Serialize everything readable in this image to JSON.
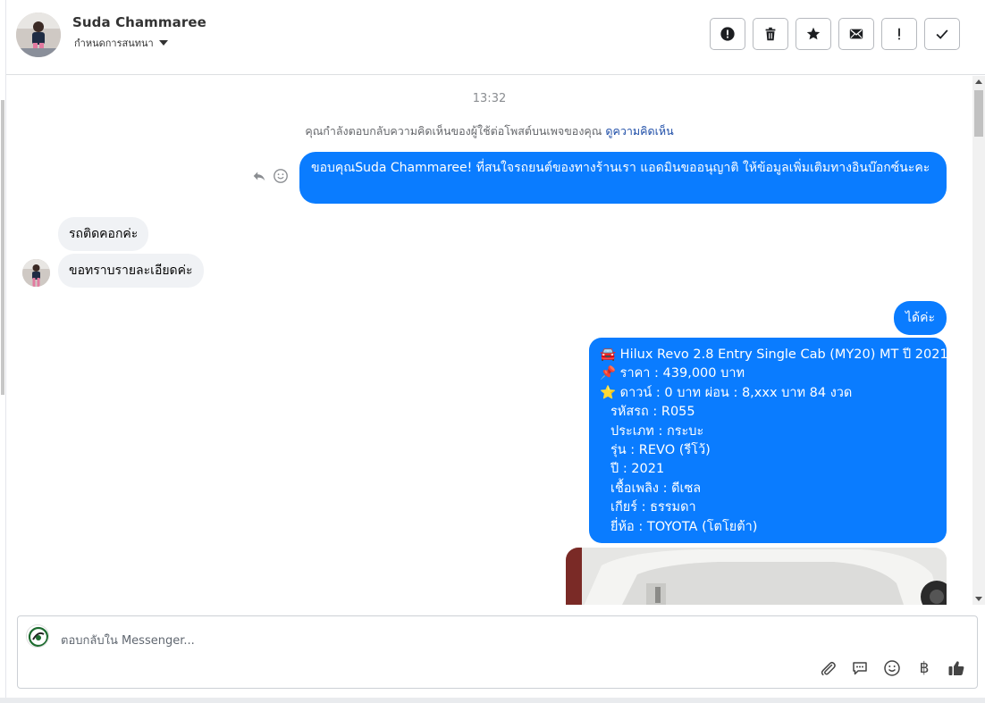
{
  "header": {
    "contact_name": "Suda Chammaree",
    "subtitle": "กำหนดการสนทนา"
  },
  "chat": {
    "timestamp": "13:32",
    "notice_text": "คุณกำลังตอบกลับความคิดเห็นของผู้ใช้ต่อโพสต์บนเพจของคุณ ",
    "notice_link": "ดูความคิดเห็น",
    "messages": [
      {
        "from": "page",
        "text": "ขอบคุณSuda Chammaree! ที่สนใจรถยนต์ของทางร้านเรา แอดมินขออนุญาติ ให้ข้อมูลเพิ่มเติมทางอินบ๊อกซ์นะคะ"
      },
      {
        "from": "user",
        "text": "รถติดคอกค่ะ"
      },
      {
        "from": "user",
        "text": "ขอทราบรายละเอียดค่ะ"
      },
      {
        "from": "page",
        "text": "ได้ค่ะ"
      }
    ],
    "car_listing": {
      "line1": "🚘 Hilux Revo 2.8 Entry Single Cab (MY20) MT ปี 2021",
      "line2": "📌 ราคา : 439,000 บาท",
      "line3": "⭐ ดาวน์ : 0 บาท ผ่อน : 8,xxx บาท 84 งวด",
      "line4": "รหัสรถ : R055",
      "line5": "ประเภท : กระบะ",
      "line6": "รุ่น : REVO (รีโว้)",
      "line7": "ปี : 2021",
      "line8": "เชื้อเพลิง : ดีเซล",
      "line9": "เกียร์ : ธรรมดา",
      "line10": "ยี่ห้อ : TOYOTA (โตโยต้า)"
    }
  },
  "composer": {
    "placeholder": "ตอบกลับใน Messenger...",
    "baht_symbol": "฿"
  },
  "icons": {
    "header_actions": [
      "alert-icon",
      "trash-icon",
      "star-icon",
      "envelope-icon",
      "exclamation-icon",
      "check-icon"
    ],
    "composer_tools": [
      "paperclip-icon",
      "chat-bubble-icon",
      "smiley-icon",
      "baht-icon",
      "thumbs-up-icon"
    ]
  },
  "colors": {
    "outgoing_bubble": "#0a7cff",
    "incoming_bubble": "#f0f2f5",
    "link": "#1f4ea8"
  }
}
